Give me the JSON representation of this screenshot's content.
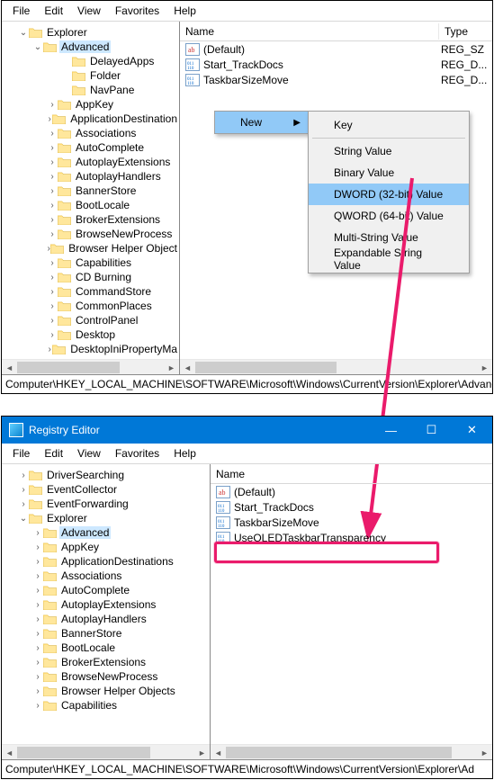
{
  "menus": {
    "file": "File",
    "edit": "Edit",
    "view": "View",
    "favorites": "Favorites",
    "help": "Help"
  },
  "top": {
    "tree": {
      "root": "Explorer",
      "selected": "Advanced",
      "items": [
        "DelayedApps",
        "Folder",
        "NavPane",
        "AppKey",
        "ApplicationDestination",
        "Associations",
        "AutoComplete",
        "AutoplayExtensions",
        "AutoplayHandlers",
        "BannerStore",
        "BootLocale",
        "BrokerExtensions",
        "BrowseNewProcess",
        "Browser Helper Object",
        "Capabilities",
        "CD Burning",
        "CommandStore",
        "CommonPlaces",
        "ControlPanel",
        "Desktop",
        "DesktopIniPropertyMa"
      ],
      "expand_first": [
        false,
        false,
        false,
        true,
        true,
        true,
        true,
        true,
        true,
        true,
        true,
        true,
        true,
        true,
        true,
        true,
        true,
        true,
        true,
        true,
        true
      ]
    },
    "list": {
      "col_name": "Name",
      "col_type": "Type",
      "rows": [
        {
          "name": "(Default)",
          "type": "REG_SZ",
          "icon": "ab"
        },
        {
          "name": "Start_TrackDocs",
          "type": "REG_D...",
          "icon": "110"
        },
        {
          "name": "TaskbarSizeMove",
          "type": "REG_D...",
          "icon": "110"
        }
      ]
    },
    "ctx": {
      "new": "New",
      "items": [
        "Key",
        "String Value",
        "Binary Value",
        "DWORD (32-bit) Value",
        "QWORD (64-bit) Value",
        "Multi-String Value",
        "Expandable String Value"
      ],
      "highlighted": 3
    },
    "status": "Computer\\HKEY_LOCAL_MACHINE\\SOFTWARE\\Microsoft\\Windows\\CurrentVersion\\Explorer\\Advanced"
  },
  "bottom": {
    "title": "Registry Editor",
    "tree": {
      "items": [
        "DriverSearching",
        "EventCollector",
        "EventForwarding"
      ],
      "explorer": "Explorer",
      "selected": "Advanced",
      "children": [
        "AppKey",
        "ApplicationDestinations",
        "Associations",
        "AutoComplete",
        "AutoplayExtensions",
        "AutoplayHandlers",
        "BannerStore",
        "BootLocale",
        "BrokerExtensions",
        "BrowseNewProcess",
        "Browser Helper Objects",
        "Capabilities"
      ]
    },
    "list": {
      "col_name": "Name",
      "rows": [
        {
          "name": "(Default)",
          "icon": "ab"
        },
        {
          "name": "Start_TrackDocs",
          "icon": "110"
        },
        {
          "name": "TaskbarSizeMove",
          "icon": "110"
        },
        {
          "name": "UseOLEDTaskbarTransparency",
          "icon": "110"
        }
      ]
    },
    "status": "Computer\\HKEY_LOCAL_MACHINE\\SOFTWARE\\Microsoft\\Windows\\CurrentVersion\\Explorer\\Ad"
  }
}
